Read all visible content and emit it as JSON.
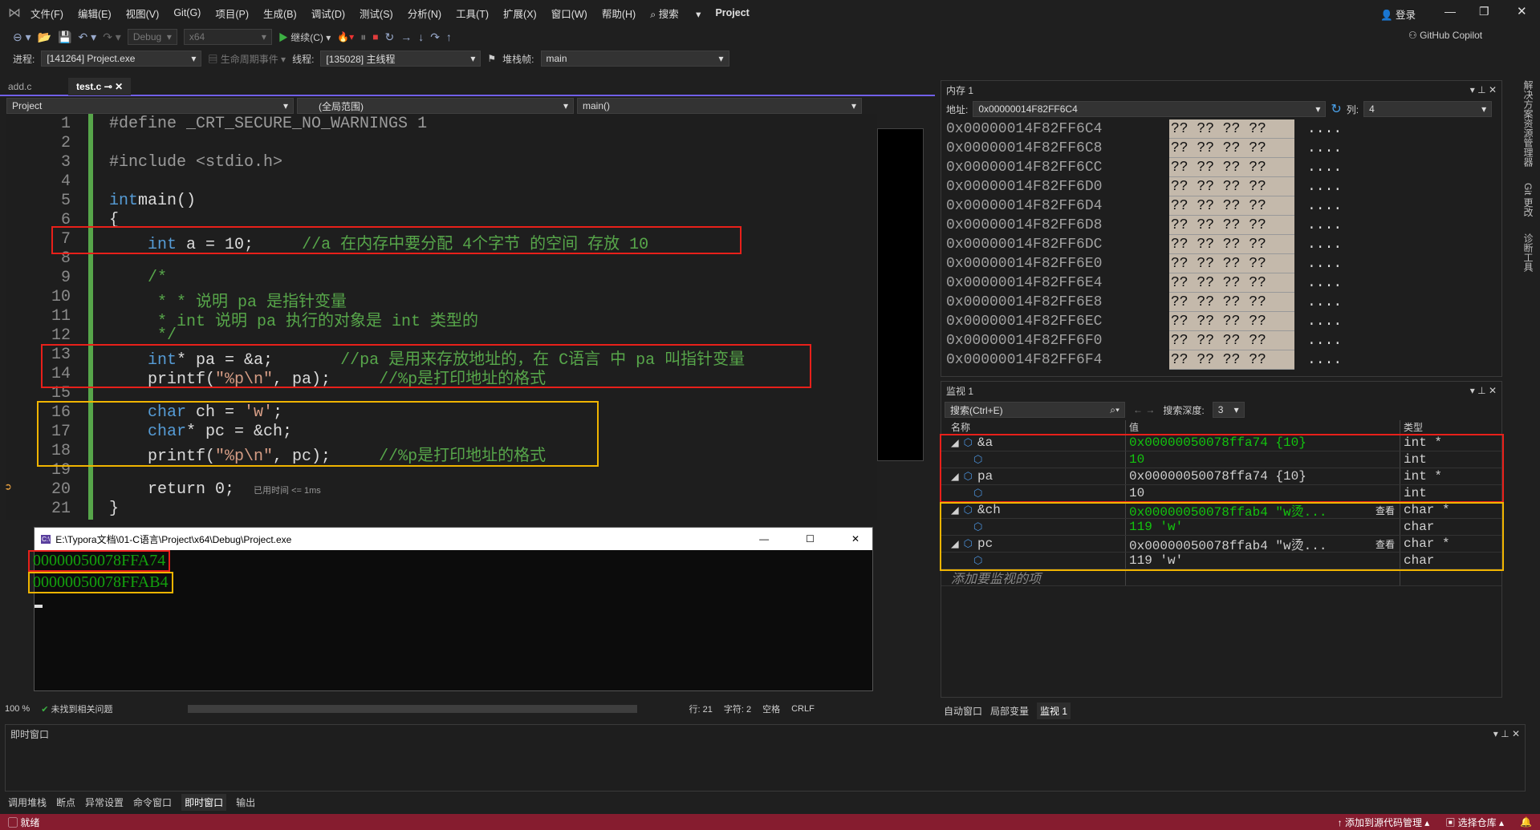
{
  "menu": {
    "items": [
      "文件(F)",
      "编辑(E)",
      "视图(V)",
      "Git(G)",
      "项目(P)",
      "生成(B)",
      "调试(D)",
      "测试(S)",
      "分析(N)",
      "工具(T)",
      "扩展(X)",
      "窗口(W)",
      "帮助(H)"
    ],
    "search": "搜索",
    "project": "Project",
    "login": "登录",
    "copilot": "GitHub Copilot"
  },
  "toolbar": {
    "config": "Debug",
    "platform": "x64",
    "continue": "继续(C)"
  },
  "debugbar": {
    "process_label": "进程:",
    "process": "[141264] Project.exe",
    "lifecycle": "生命周期事件",
    "thread_label": "线程:",
    "thread": "[135028] 主线程",
    "stack_label": "堆栈帧:",
    "stack": "main"
  },
  "editor": {
    "tabs": [
      "add.c",
      "test.c"
    ],
    "nav": [
      "Project",
      "(全局范围)",
      "main()"
    ],
    "lines": [
      [
        [
          "pp",
          "#define _CRT_SECURE_NO_WARNINGS 1"
        ]
      ],
      [],
      [
        [
          "pp",
          "#include <stdio.h>"
        ]
      ],
      [],
      [
        [
          "kw",
          "int"
        ],
        [
          "",
          "main()"
        ]
      ],
      [
        [
          "",
          "{"
        ]
      ],
      [
        [
          "",
          "    "
        ],
        [
          "kw",
          "int"
        ],
        [
          "",
          " a = 10;     "
        ],
        [
          "cm",
          "//a 在内存中要分配 4个字节 的空间 存放 10"
        ]
      ],
      [],
      [
        [
          "cm",
          "    /*"
        ]
      ],
      [
        [
          "cm",
          "     * * 说明 pa 是指针变量"
        ]
      ],
      [
        [
          "cm",
          "     * int 说明 pa 执行的对象是 int 类型的"
        ]
      ],
      [
        [
          "cm",
          "     */"
        ]
      ],
      [
        [
          "",
          "    "
        ],
        [
          "kw",
          "int"
        ],
        [
          "",
          "* pa = &a;       "
        ],
        [
          "cm",
          "//pa 是用来存放地址的，在 C语言 中 pa 叫指针变量"
        ]
      ],
      [
        [
          "",
          "    printf("
        ],
        [
          "st",
          "\"%p\\n\""
        ],
        [
          "",
          ", pa);     "
        ],
        [
          "cm",
          "//%p是打印地址的格式"
        ]
      ],
      [],
      [
        [
          "",
          "    "
        ],
        [
          "kw",
          "char"
        ],
        [
          "",
          " ch = "
        ],
        [
          "st",
          "'w'"
        ],
        [
          "",
          ";"
        ]
      ],
      [
        [
          "",
          "    "
        ],
        [
          "kw",
          "char"
        ],
        [
          "",
          "* pc = &ch;"
        ]
      ],
      [
        [
          "",
          "    printf("
        ],
        [
          "st",
          "\"%p\\n\""
        ],
        [
          "",
          ", pc);     "
        ],
        [
          "cm",
          "//%p是打印地址的格式"
        ]
      ],
      [],
      [
        [
          "",
          "    return 0;  "
        ],
        [
          "small",
          "已用时间 <= 1ms"
        ]
      ],
      [
        [
          "",
          "}"
        ]
      ]
    ]
  },
  "console": {
    "title": "E:\\Typora文档\\01-C语言\\Project\\x64\\Debug\\Project.exe",
    "output": [
      "00000050078FFA74",
      "00000050078FFAB4"
    ]
  },
  "editor_status": {
    "zoom": "100 %",
    "issues": "未找到相关问题",
    "line": "行: 21",
    "char": "字符: 2",
    "space": "空格",
    "eol": "CRLF"
  },
  "memory": {
    "title": "内存 1",
    "addr_label": "地址:",
    "addr": "0x00000014F82FF6C4",
    "cols_label": "列:",
    "cols": "4",
    "rows": [
      "0x00000014F82FF6C4",
      "0x00000014F82FF6C8",
      "0x00000014F82FF6CC",
      "0x00000014F82FF6D0",
      "0x00000014F82FF6D4",
      "0x00000014F82FF6D8",
      "0x00000014F82FF6DC",
      "0x00000014F82FF6E0",
      "0x00000014F82FF6E4",
      "0x00000014F82FF6E8",
      "0x00000014F82FF6EC",
      "0x00000014F82FF6F0",
      "0x00000014F82FF6F4"
    ],
    "bytes": "?? ?? ?? ??",
    "chars": "...."
  },
  "watch": {
    "title": "监视 1",
    "search": "搜索(Ctrl+E)",
    "depth_label": "搜索深度:",
    "depth": "3",
    "headers": [
      "名称",
      "值",
      "类型"
    ],
    "view": "查看",
    "add": "添加要监视的项",
    "rows": [
      {
        "name": "&a",
        "value": "0x00000050078ffa74 {10}",
        "type": "int *",
        "child": false,
        "changed": true
      },
      {
        "name": "",
        "value": "10",
        "type": "int",
        "child": true,
        "changed": true
      },
      {
        "name": "pa",
        "value": "0x00000050078ffa74 {10}",
        "type": "int *",
        "child": false,
        "changed": false
      },
      {
        "name": "",
        "value": "10",
        "type": "int",
        "child": true,
        "changed": false
      },
      {
        "name": "&ch",
        "value": "0x00000050078ffab4 \"w烫...",
        "type": "char *",
        "child": false,
        "changed": true,
        "view": true
      },
      {
        "name": "",
        "value": "119 'w'",
        "type": "char",
        "child": true,
        "changed": true
      },
      {
        "name": "pc",
        "value": "0x00000050078ffab4 \"w烫...",
        "type": "char *",
        "child": false,
        "changed": false,
        "view": true
      },
      {
        "name": "",
        "value": "119 'w'",
        "type": "char",
        "child": true,
        "changed": false
      }
    ]
  },
  "right_tabs": [
    "自动窗口",
    "局部变量",
    "监视 1"
  ],
  "side_tabs": [
    "解决方案资源管理器",
    "Git 更改",
    "诊断工具"
  ],
  "immediate": {
    "title": "即时窗口"
  },
  "bottom_tabs": [
    "调用堆栈",
    "断点",
    "异常设置",
    "命令窗口",
    "即时窗口",
    "输出"
  ],
  "statusbar": {
    "ready": "就绪",
    "add_source": "添加到源代码管理",
    "select_repo": "选择仓库"
  },
  "colors": {
    "status": "#861c2f",
    "accent": "#7160e8",
    "comment": "#57a64a",
    "keyword": "#569cd6",
    "box_red": "#e8201a",
    "box_yellow": "#f0b400"
  }
}
